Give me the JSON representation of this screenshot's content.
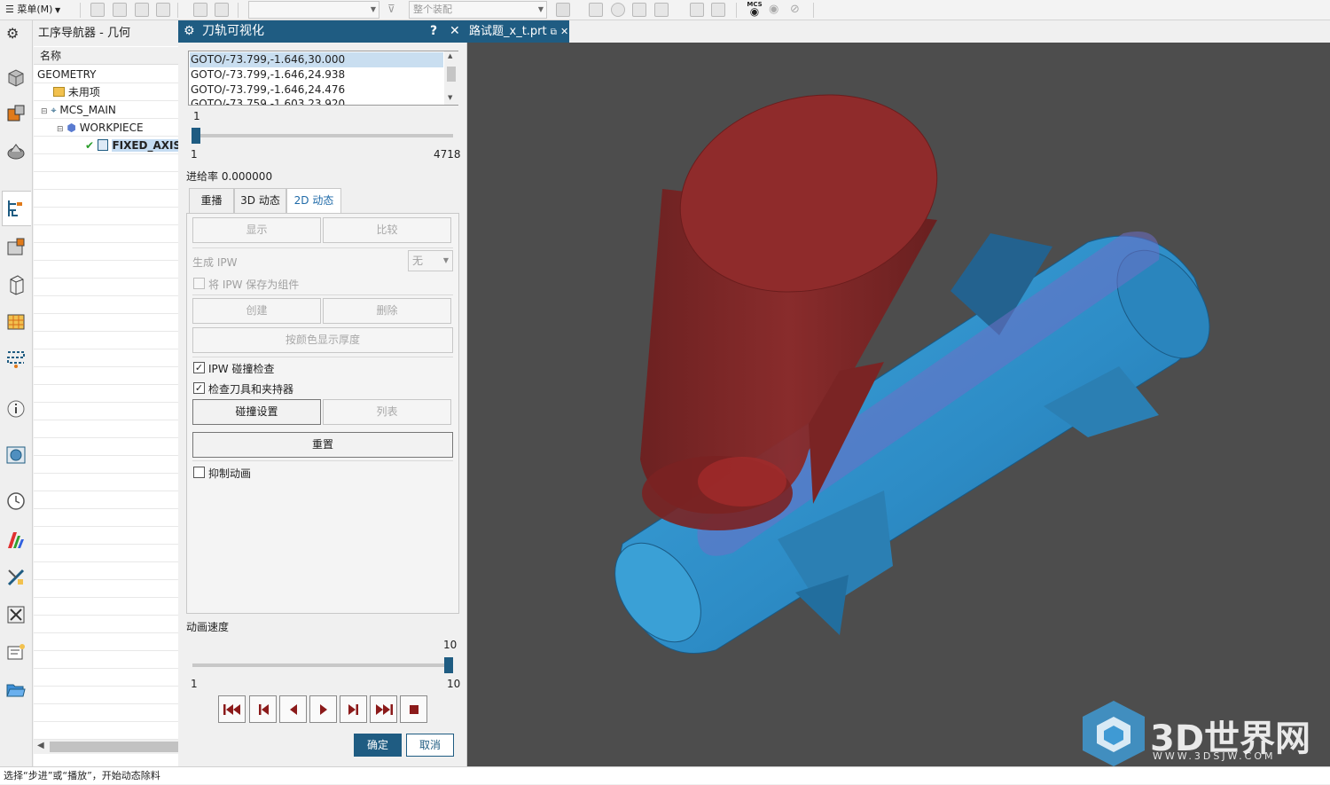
{
  "toolbar": {
    "menu_label": "菜单(M)",
    "assembly_combo": "整个装配",
    "mcs_label": "MCS"
  },
  "navigator": {
    "title": "工序导航器 - 几何",
    "column_header": "名称",
    "rows": [
      "GEOMETRY",
      "未用项",
      "MCS_MAIN",
      "WORKPIECE",
      "FIXED_AXIS"
    ]
  },
  "dialog": {
    "title": "刀轨可视化",
    "help": "?",
    "close": "✕",
    "goto_lines": [
      "GOTO/-73.799,-1.646,30.000",
      "GOTO/-73.799,-1.646,24.938",
      "GOTO/-73.799,-1.646,24.476",
      "GOTO/-73.759,-1.603,23.920"
    ],
    "step_current": "1",
    "step_min": "1",
    "step_max": "4718",
    "feedrate": "进给率 0.000000",
    "tabs": [
      "重播",
      "3D 动态",
      "2D 动态"
    ],
    "active_tab": "2D 动态",
    "display_btn": "显示",
    "compare_btn": "比较",
    "gen_ipw_label": "生成 IPW",
    "gen_ipw_value": "无",
    "save_ipw_label": "将 IPW 保存为组件",
    "create_btn": "创建",
    "delete_btn": "删除",
    "thickness_btn": "按颜色显示厚度",
    "ipw_collision_label": "IPW 碰撞检查",
    "check_tool_label": "检查刀具和夹持器",
    "collision_settings_btn": "碰撞设置",
    "list_btn": "列表",
    "reset_btn": "重置",
    "suppress_anim_label": "抑制动画",
    "speed_label": "动画速度",
    "speed_value": "10",
    "speed_min": "1",
    "speed_max": "10",
    "speed_fraction": 1.0,
    "ok_btn": "确定",
    "cancel_btn": "取消"
  },
  "document_tab": {
    "name": "路试题_x_t.prt",
    "close": "✕"
  },
  "watermark": {
    "text": "3D世界网",
    "url": "WWW.3DSJW.COM"
  },
  "status_text": "选择“步进”或“播放”，开始动态除料",
  "colors": {
    "accent": "#1f5c82",
    "tool": "#8c2a2a",
    "part": "#2f8fc4",
    "viewport_bg": "#4d4d4d"
  }
}
